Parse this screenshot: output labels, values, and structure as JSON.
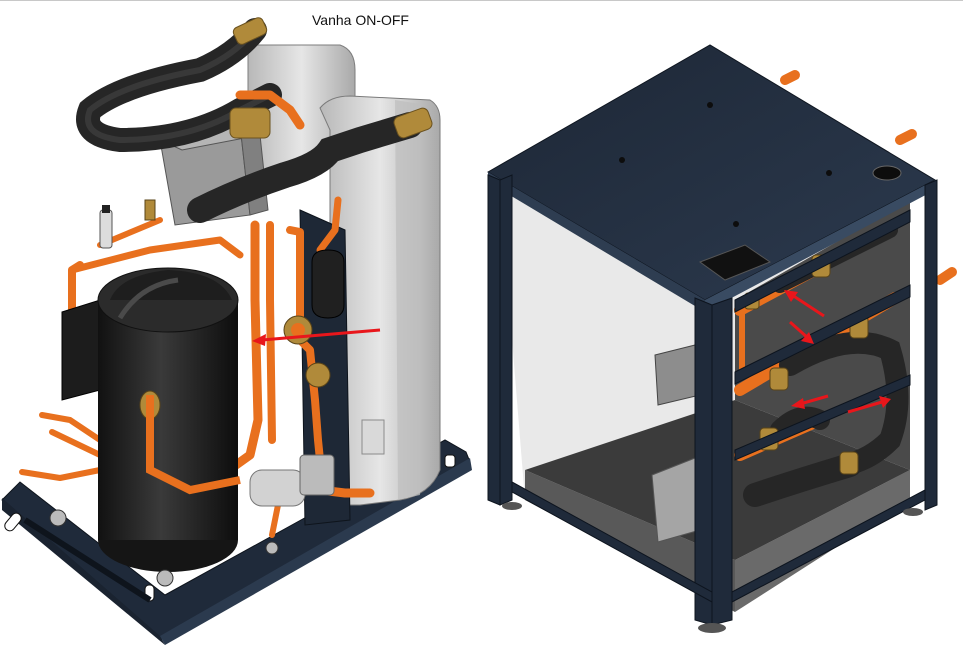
{
  "caption": "Vanha ON-OFF",
  "colors": {
    "pipe": "#e8701e",
    "pipe_dark": "#b4500f",
    "insulation": "#2a2a2a",
    "compressor": "#232323",
    "frame": "#1f2a3a",
    "frame_edge": "#34465c",
    "heat_exchanger": "#c9c9c9",
    "fitting": "#b08a3a",
    "arrow": "#e8161b",
    "box": "#9a9a9a"
  },
  "views": [
    {
      "id": "left-assembly-view",
      "arrow_count": 1
    },
    {
      "id": "right-cabinet-view",
      "arrow_count": 4
    }
  ]
}
